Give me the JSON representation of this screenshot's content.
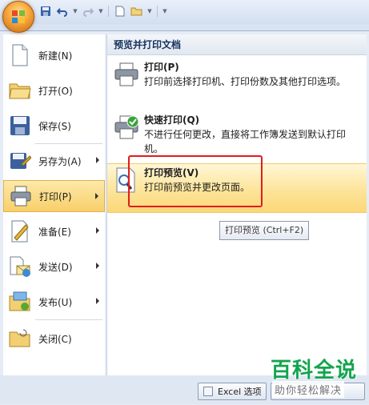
{
  "left_menu": {
    "items": [
      {
        "label": "新建(N)",
        "icon": "new-document-icon",
        "arrow": false
      },
      {
        "label": "打开(O)",
        "icon": "open-folder-icon",
        "arrow": false
      },
      {
        "label": "保存(S)",
        "icon": "save-disk-icon",
        "arrow": false
      },
      {
        "label": "另存为(A)",
        "icon": "save-as-icon",
        "arrow": true
      },
      {
        "label": "打印(P)",
        "icon": "printer-icon",
        "arrow": true,
        "active": true
      },
      {
        "label": "准备(E)",
        "icon": "prepare-icon",
        "arrow": true
      },
      {
        "label": "发送(D)",
        "icon": "send-icon",
        "arrow": true
      },
      {
        "label": "发布(U)",
        "icon": "publish-icon",
        "arrow": true
      },
      {
        "label": "关闭(C)",
        "icon": "close-folder-icon",
        "arrow": false
      }
    ]
  },
  "right_panel": {
    "header": "预览并打印文档",
    "items": [
      {
        "title": "打印(P)",
        "desc": "打印前选择打印机、打印份数及其他打印选项。",
        "icon": "printer-icon"
      },
      {
        "title": "快速打印(Q)",
        "desc": "不进行任何更改，直接将工作簿发送到默认打印机。",
        "icon": "quick-print-icon"
      },
      {
        "title": "打印预览(V)",
        "desc": "打印前预览并更改页面。",
        "icon": "print-preview-icon",
        "highlighted": true
      }
    ]
  },
  "tooltip": "打印预览 (Ctrl+F2)",
  "bottom": {
    "options_button": "Excel 选项"
  },
  "watermark": {
    "title": "百科全说",
    "subtitle": "助你轻松解决"
  },
  "colors": {
    "highlight": "#fbd777",
    "annotation_box": "#e21c1c",
    "watermark_green": "#13a44e"
  }
}
